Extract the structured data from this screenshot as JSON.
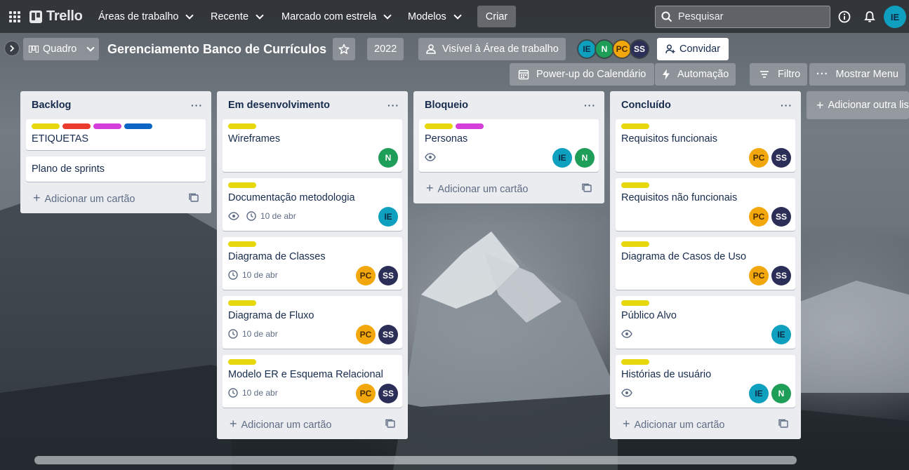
{
  "nav": {
    "brand": "Trello",
    "menus": [
      {
        "label": "Áreas de trabalho"
      },
      {
        "label": "Recente"
      },
      {
        "label": "Marcado com estrela"
      },
      {
        "label": "Modelos"
      }
    ],
    "create_label": "Criar",
    "search_placeholder": "Pesquisar",
    "user_initials": "IE",
    "icons": [
      "apps-grid-icon",
      "info-icon",
      "bell-icon"
    ]
  },
  "board": {
    "view_label": "Quadro",
    "title": "Gerenciamento Banco de Currículos",
    "year_badge": "2022",
    "visibility_label": "Visível à Área de trabalho",
    "members": [
      "IE",
      "N",
      "PC",
      "SS"
    ],
    "invite_label": "Convidar",
    "calendar_label": "Power-up do Calendário",
    "automation_label": "Automação",
    "filter_label": "Filtro",
    "menu_label": "Mostrar Menu"
  },
  "colors": {
    "yellow": "#e6d80c",
    "red": "#eb3b2f",
    "magenta": "#d53fd9",
    "blue": "#0c66c6",
    "ie": "#0fa0c0",
    "n": "#1f9e5a",
    "pc": "#f2a80c",
    "ss": "#2b2f57"
  },
  "lists": [
    {
      "title": "Backlog",
      "add_label": "Adicionar um cartão",
      "cards": [
        {
          "title": "ETIQUETAS",
          "labels": [
            "yellow",
            "red",
            "magenta",
            "blue"
          ]
        },
        {
          "title": "Plano de sprints"
        }
      ]
    },
    {
      "title": "Em desenvolvimento",
      "add_label": "Adicionar um cartão",
      "cards": [
        {
          "title": "Wireframes",
          "labels": [
            "yellow"
          ],
          "members": [
            "N"
          ]
        },
        {
          "title": "Documentação metodologia",
          "labels": [
            "yellow"
          ],
          "watch": true,
          "due": "10 de abr",
          "members": [
            "IE"
          ]
        },
        {
          "title": "Diagrama de Classes",
          "labels": [
            "yellow"
          ],
          "due": "10 de abr",
          "members": [
            "PC",
            "SS"
          ]
        },
        {
          "title": "Diagrama de Fluxo",
          "labels": [
            "yellow"
          ],
          "due": "10 de abr",
          "members": [
            "PC",
            "SS"
          ]
        },
        {
          "title": "Modelo ER e Esquema Relacional",
          "labels": [
            "yellow"
          ],
          "due": "10 de abr",
          "members": [
            "PC",
            "SS"
          ]
        }
      ]
    },
    {
      "title": "Bloqueio",
      "add_label": "Adicionar um cartão",
      "cards": [
        {
          "title": "Personas",
          "labels": [
            "yellow",
            "magenta"
          ],
          "watch": true,
          "members": [
            "IE",
            "N"
          ]
        }
      ]
    },
    {
      "title": "Concluído",
      "add_label": "Adicionar um cartão",
      "cards": [
        {
          "title": "Requisitos funcionais",
          "labels": [
            "yellow"
          ],
          "members": [
            "PC",
            "SS"
          ]
        },
        {
          "title": "Requisitos não funcionais",
          "labels": [
            "yellow"
          ],
          "members": [
            "PC",
            "SS"
          ]
        },
        {
          "title": "Diagrama de Casos de Uso",
          "labels": [
            "yellow"
          ],
          "members": [
            "PC",
            "SS"
          ]
        },
        {
          "title": "Público Alvo",
          "labels": [
            "yellow"
          ],
          "watch": true,
          "members": [
            "IE"
          ]
        },
        {
          "title": "Histórias de usuário",
          "labels": [
            "yellow"
          ],
          "watch": true,
          "members": [
            "IE",
            "N"
          ]
        }
      ]
    }
  ],
  "add_list_label": "Adicionar outra lista"
}
